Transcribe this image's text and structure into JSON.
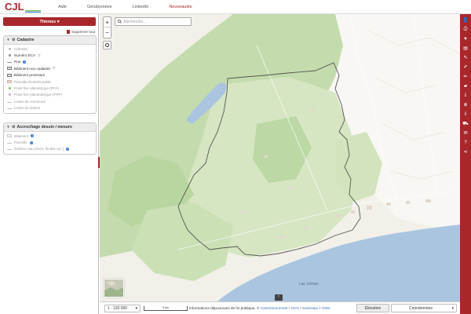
{
  "topbar": {
    "logo_text": "CJL",
    "nav": [
      {
        "label": "Aide",
        "active": false
      },
      {
        "label": "Géodonnées",
        "active": false
      },
      {
        "label": "LinkedIn",
        "active": false
      },
      {
        "label": "Nouveautés",
        "active": true
      }
    ]
  },
  "left_panel": {
    "themes_label": "Thèmes ▾",
    "remove_all_label": "Supprimer tout",
    "groups": [
      {
        "title": "Cadastre",
        "layers": [
          {
            "label": "Adresse",
            "symbol": "dot",
            "dim": true
          },
          {
            "label": "Numéro ECA",
            "symbol": "ring",
            "dim": false,
            "badge": "▽"
          },
          {
            "label": "Rue",
            "symbol": "wave",
            "dim": false,
            "badge": "i"
          },
          {
            "label": "Bâtiment non cadastré",
            "symbol": "rect",
            "dim": false,
            "badge": "▽"
          },
          {
            "label": "Bâtiment provisoire",
            "symbol": "rect",
            "dim": false
          },
          {
            "label": "Parcelle d'intérêt public",
            "symbol": "rect-hatch",
            "dim": true
          },
          {
            "label": "Point fixe altimétrique (PFA)",
            "symbol": "dot-green",
            "dim": true
          },
          {
            "label": "Point fixe planimétrique (PFP)",
            "symbol": "dot-pink",
            "dim": true
          },
          {
            "label": "Limite de commune",
            "symbol": "wave-light",
            "dim": true
          },
          {
            "label": "Limite de district",
            "symbol": "wave-light",
            "dim": true
          }
        ]
      },
      {
        "title": "Accrochage dessin / mesure",
        "layers": [
          {
            "label": "Bâtiment",
            "symbol": "rect-light",
            "dim": true,
            "badge": "i"
          },
          {
            "label": "Parcelle",
            "symbol": "wave-light",
            "dim": true,
            "badge": "i"
          },
          {
            "label": "Surface eau (rives, limites etc.)",
            "symbol": "wave-light",
            "dim": true,
            "badge": "i"
          }
        ]
      }
    ]
  },
  "map": {
    "search_placeholder": "Recherche...",
    "zoom_in": "+",
    "zoom_out": "−",
    "lake_label": "Lac Léman"
  },
  "right_toolbar": {
    "tools": [
      "add-user-icon",
      "print-icon",
      "filter-icon",
      "printer-icon",
      "pencil-icon",
      "draw-icon",
      "edit-icon",
      "folder-icon",
      "download-icon",
      "zoom-icon",
      "export-icon",
      "cart-icon",
      "mail-icon",
      "help-icon",
      "share-icon"
    ]
  },
  "bottom_bar": {
    "scale_value": "1 : 120 000",
    "scalebar_label": "5 km",
    "attribution_prefix": "Informations dépourvues de foi publique, © ",
    "attribution_links": [
      "CartoGeoLeman",
      "OCG",
      "swisstopo",
      "OSM"
    ],
    "elevation_label": "Élévation",
    "coordinates_label": "Coordonnées"
  },
  "colors": {
    "brand": "#a8272b",
    "forest": "#bcd8a4",
    "lake": "#a9c5e0",
    "land": "#f1efe8"
  }
}
